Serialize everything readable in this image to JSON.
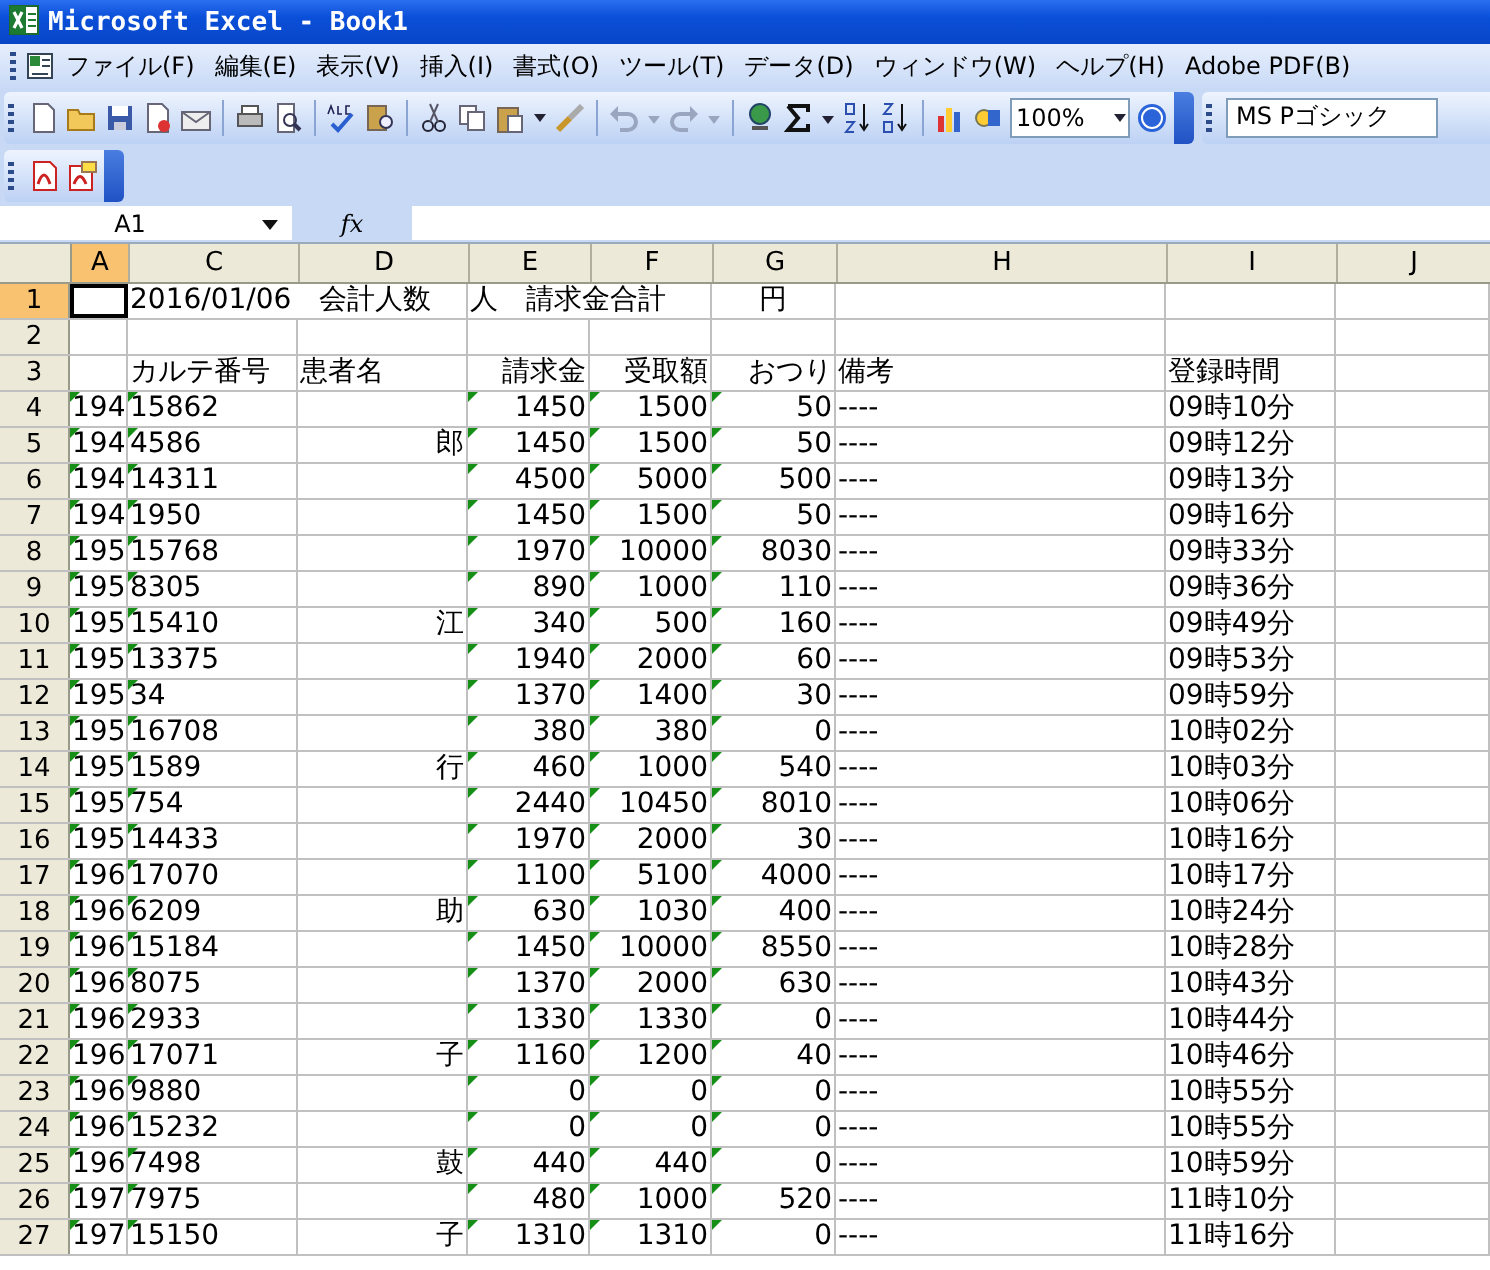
{
  "window": {
    "title": "Microsoft Excel - Book1"
  },
  "menu_bar": {
    "items": [
      "ファイル(F)",
      "編集(E)",
      "表示(V)",
      "挿入(I)",
      "書式(O)",
      "ツール(T)",
      "データ(D)",
      "ウィンドウ(W)",
      "ヘルプ(H)",
      "Adobe PDF(B)"
    ]
  },
  "toolbar": {
    "zoom": "100%",
    "font": "MS Pゴシック"
  },
  "formula_bar": {
    "name_box": "A1",
    "function_label": "fx"
  },
  "columns": [
    {
      "label": "A",
      "selected": true
    },
    {
      "label": "C",
      "selected": false
    },
    {
      "label": "D",
      "selected": false
    },
    {
      "label": "E",
      "selected": false
    },
    {
      "label": "F",
      "selected": false
    },
    {
      "label": "G",
      "selected": false
    },
    {
      "label": "H",
      "selected": false
    },
    {
      "label": "I",
      "selected": false
    },
    {
      "label": "J",
      "selected": false
    }
  ],
  "rows": [
    {
      "number": "1",
      "selected": true,
      "kind": "title",
      "c": "2016/01/06　会計人数",
      "e": "人　請求金合計",
      "g": "円"
    },
    {
      "number": "2",
      "selected": false,
      "kind": "blank"
    },
    {
      "number": "3",
      "selected": false,
      "kind": "header",
      "c": "カルテ番号",
      "d": "患者名",
      "e": "請求金",
      "f": "受取額",
      "g": "おつり",
      "h": "備考",
      "i": "登録時間"
    },
    {
      "number": "4",
      "selected": false,
      "kind": "record",
      "error_indicators": true,
      "a": "194",
      "c": "15862",
      "e": "1450",
      "f": "1500",
      "g": "50",
      "h": "----",
      "i": "09時10分"
    },
    {
      "number": "5",
      "selected": false,
      "kind": "record",
      "error_indicators": true,
      "a": "194",
      "c": "4586",
      "d": "郎",
      "e": "1450",
      "f": "1500",
      "g": "50",
      "h": "----",
      "i": "09時12分"
    },
    {
      "number": "6",
      "selected": false,
      "kind": "record",
      "error_indicators": true,
      "a": "194",
      "c": "14311",
      "e": "4500",
      "f": "5000",
      "g": "500",
      "h": "----",
      "i": "09時13分"
    },
    {
      "number": "7",
      "selected": false,
      "kind": "record",
      "error_indicators": true,
      "a": "194",
      "c": "1950",
      "e": "1450",
      "f": "1500",
      "g": "50",
      "h": "----",
      "i": "09時16分"
    },
    {
      "number": "8",
      "selected": false,
      "kind": "record",
      "error_indicators": true,
      "a": "195",
      "c": "15768",
      "e": "1970",
      "f": "10000",
      "g": "8030",
      "h": "----",
      "i": "09時33分"
    },
    {
      "number": "9",
      "selected": false,
      "kind": "record",
      "error_indicators": true,
      "a": "195",
      "c": "8305",
      "e": "890",
      "f": "1000",
      "g": "110",
      "h": "----",
      "i": "09時36分"
    },
    {
      "number": "10",
      "selected": false,
      "kind": "record",
      "error_indicators": true,
      "a": "195",
      "c": "15410",
      "d": "江",
      "e": "340",
      "f": "500",
      "g": "160",
      "h": "----",
      "i": "09時49分"
    },
    {
      "number": "11",
      "selected": false,
      "kind": "record",
      "error_indicators": true,
      "a": "195",
      "c": "13375",
      "e": "1940",
      "f": "2000",
      "g": "60",
      "h": "----",
      "i": "09時53分"
    },
    {
      "number": "12",
      "selected": false,
      "kind": "record",
      "error_indicators": true,
      "a": "195",
      "c": "34",
      "e": "1370",
      "f": "1400",
      "g": "30",
      "h": "----",
      "i": "09時59分"
    },
    {
      "number": "13",
      "selected": false,
      "kind": "record",
      "error_indicators": true,
      "a": "195",
      "c": "16708",
      "e": "380",
      "f": "380",
      "g": "0",
      "h": "----",
      "i": "10時02分"
    },
    {
      "number": "14",
      "selected": false,
      "kind": "record",
      "error_indicators": true,
      "a": "195",
      "c": "1589",
      "d": "行",
      "e": "460",
      "f": "1000",
      "g": "540",
      "h": "----",
      "i": "10時03分"
    },
    {
      "number": "15",
      "selected": false,
      "kind": "record",
      "error_indicators": true,
      "a": "195",
      "c": "754",
      "e": "2440",
      "f": "10450",
      "g": "8010",
      "h": "----",
      "i": "10時06分"
    },
    {
      "number": "16",
      "selected": false,
      "kind": "record",
      "error_indicators": true,
      "a": "195",
      "c": "14433",
      "e": "1970",
      "f": "2000",
      "g": "30",
      "h": "----",
      "i": "10時16分"
    },
    {
      "number": "17",
      "selected": false,
      "kind": "record",
      "error_indicators": true,
      "a": "196",
      "c": "17070",
      "e": "1100",
      "f": "5100",
      "g": "4000",
      "h": "----",
      "i": "10時17分"
    },
    {
      "number": "18",
      "selected": false,
      "kind": "record",
      "error_indicators": true,
      "a": "196",
      "c": "6209",
      "d": "助",
      "e": "630",
      "f": "1030",
      "g": "400",
      "h": "----",
      "i": "10時24分"
    },
    {
      "number": "19",
      "selected": false,
      "kind": "record",
      "error_indicators": true,
      "a": "196",
      "c": "15184",
      "e": "1450",
      "f": "10000",
      "g": "8550",
      "h": "----",
      "i": "10時28分"
    },
    {
      "number": "20",
      "selected": false,
      "kind": "record",
      "error_indicators": true,
      "a": "196",
      "c": "8075",
      "e": "1370",
      "f": "2000",
      "g": "630",
      "h": "----",
      "i": "10時43分"
    },
    {
      "number": "21",
      "selected": false,
      "kind": "record",
      "error_indicators": true,
      "a": "196",
      "c": "2933",
      "e": "1330",
      "f": "1330",
      "g": "0",
      "h": "----",
      "i": "10時44分"
    },
    {
      "number": "22",
      "selected": false,
      "kind": "record",
      "error_indicators": true,
      "a": "196",
      "c": "17071",
      "d": "子",
      "e": "1160",
      "f": "1200",
      "g": "40",
      "h": "----",
      "i": "10時46分"
    },
    {
      "number": "23",
      "selected": false,
      "kind": "record",
      "error_indicators": true,
      "a": "196",
      "c": "9880",
      "e": "0",
      "f": "0",
      "g": "0",
      "h": "----",
      "i": "10時55分"
    },
    {
      "number": "24",
      "selected": false,
      "kind": "record",
      "error_indicators": true,
      "a": "196",
      "c": "15232",
      "e": "0",
      "f": "0",
      "g": "0",
      "h": "----",
      "i": "10時55分"
    },
    {
      "number": "25",
      "selected": false,
      "kind": "record",
      "error_indicators": true,
      "a": "196",
      "c": "7498",
      "d": "鼓",
      "e": "440",
      "f": "440",
      "g": "0",
      "h": "----",
      "i": "10時59分"
    },
    {
      "number": "26",
      "selected": false,
      "kind": "record",
      "error_indicators": true,
      "a": "197",
      "c": "7975",
      "e": "480",
      "f": "1000",
      "g": "520",
      "h": "----",
      "i": "11時10分"
    },
    {
      "number": "27",
      "selected": false,
      "kind": "record",
      "error_indicators": true,
      "a": "197",
      "c": "15150",
      "d": "子",
      "e": "1310",
      "f": "1310",
      "g": "0",
      "h": "----",
      "i": "11時16分"
    }
  ]
}
